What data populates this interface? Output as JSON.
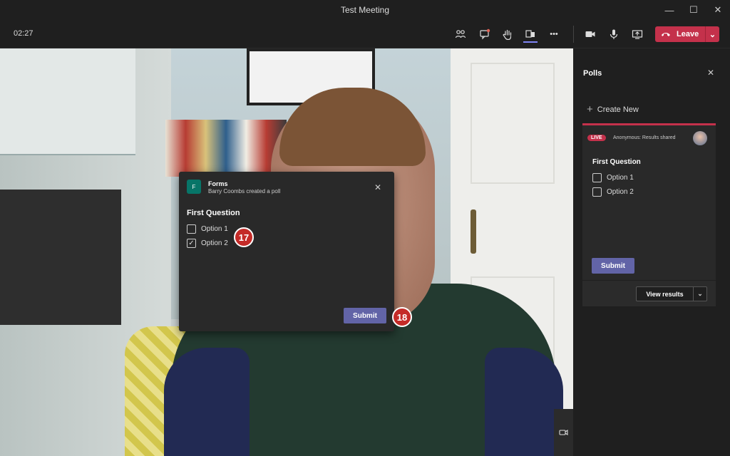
{
  "window": {
    "title": "Test Meeting",
    "controls": [
      "—",
      "☐",
      "✕"
    ]
  },
  "toolbar": {
    "timer": "02:27",
    "icons": [
      "people-icon",
      "chat-icon",
      "raise-hand-icon",
      "apps-icon",
      "more-icon",
      "camera-icon",
      "mic-icon",
      "share-icon"
    ],
    "more_glyph": "•••",
    "leave_label": "Leave",
    "leave_dropdown": "⌄",
    "accent": "#7f85f5",
    "leave_color": "#c4314b"
  },
  "poll_popup": {
    "app_name": "Forms",
    "subtitle": "Barry Coombs created a poll",
    "close": "✕",
    "logo_text": "F",
    "question": "First Question",
    "options": [
      {
        "label": "Option 1",
        "checked": false
      },
      {
        "label": "Option 2",
        "checked": true
      }
    ],
    "check_glyph": "✓",
    "submit_label": "Submit",
    "badges": [
      "17",
      "18"
    ]
  },
  "sidebar": {
    "title": "Polls",
    "close": "✕",
    "create_plus": "+",
    "create_label": "Create New",
    "card": {
      "live_label": "LIVE",
      "status_text": "Anonymous: Results shared",
      "question": "First Question",
      "options": [
        {
          "label": "Option 1",
          "checked": false
        },
        {
          "label": "Option 2",
          "checked": false
        }
      ],
      "submit_label": "Submit"
    },
    "view_results_label": "View results",
    "view_results_dropdown": "⌄"
  }
}
